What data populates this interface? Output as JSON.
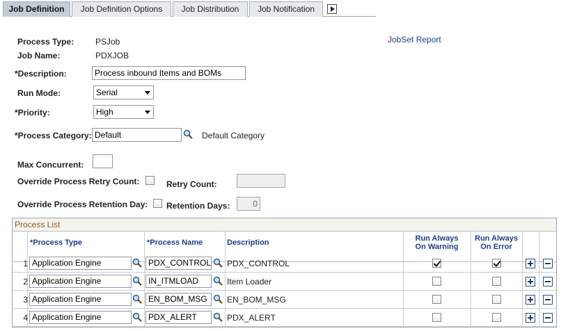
{
  "tabs": [
    {
      "label": "Job Definition",
      "active": true
    },
    {
      "label": "Job Definition Options",
      "active": false
    },
    {
      "label": "Job Distribution",
      "active": false
    },
    {
      "label": "Job Notification",
      "active": false
    }
  ],
  "form": {
    "process_type_label": "Process Type:",
    "process_type_value": "PSJob",
    "job_name_label": "Job Name:",
    "job_name_value": "PDXJOB",
    "jobset_report_link": "JobSet Report",
    "description_label": "*Description:",
    "description_value": "Process inbound Items and BOMs",
    "run_mode_label": "Run Mode:",
    "run_mode_value": "Serial",
    "priority_label": "*Priority:",
    "priority_value": "High",
    "process_category_label": "*Process Category:",
    "process_category_value": "Default",
    "process_category_desc": "Default Category",
    "max_concurrent_label": "Max Concurrent:",
    "max_concurrent_value": "",
    "override_retry_label": "Override Process Retry Count:",
    "override_retry_checked": false,
    "retry_count_label": "Retry Count:",
    "retry_count_value": "",
    "override_retention_label": "Override Process Retention Day:",
    "override_retention_checked": false,
    "retention_days_label": "Retention Days:",
    "retention_days_value": "0"
  },
  "process_list": {
    "title": "Process List",
    "headers": {
      "process_type": "*Process Type",
      "process_name": "*Process Name",
      "description": "Description",
      "run_always_warning": [
        "Run Always",
        "On Warning"
      ],
      "run_always_error": [
        "Run Always",
        "On Error"
      ]
    },
    "rows": [
      {
        "num": "1",
        "type": "Application Engine",
        "name": "PDX_CONTROL",
        "desc": "PDX_CONTROL",
        "on_warning": true,
        "on_error": true
      },
      {
        "num": "2",
        "type": "Application Engine",
        "name": "IN_ITMLOAD",
        "desc": "Item Loader",
        "on_warning": false,
        "on_error": false
      },
      {
        "num": "3",
        "type": "Application Engine",
        "name": "EN_BOM_MSG",
        "desc": "EN_BOM_MSG",
        "on_warning": false,
        "on_error": false
      },
      {
        "num": "4",
        "type": "Application Engine",
        "name": "PDX_ALERT",
        "desc": "PDX_ALERT",
        "on_warning": false,
        "on_error": false
      }
    ]
  },
  "colors": {
    "link": "#1f3c8a",
    "grid_title": "#9c5a1a",
    "active_tab": "#c4cdd6"
  },
  "icons": {
    "lookup": "magnifier-icon",
    "add_row": "plus-icon",
    "delete_row": "minus-icon",
    "tab_scroll": "right-arrow-icon"
  }
}
